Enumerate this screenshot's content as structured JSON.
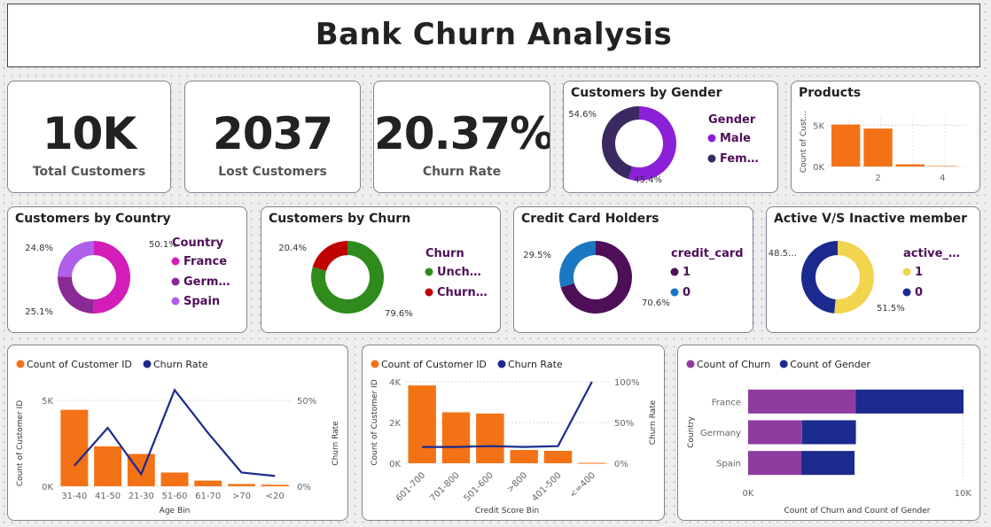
{
  "title": "Bank  Churn Analysis",
  "kpis": [
    {
      "value": "10K",
      "label": "Total Customers"
    },
    {
      "value": "2037",
      "label": "Lost Customers"
    },
    {
      "value": "20.37%",
      "label": "Churn Rate"
    }
  ],
  "colors": {
    "orange": "#F47216",
    "navy": "#1B2A8E",
    "purple": "#8E3CA0",
    "magenta": "#D21DB8",
    "darkPurple": "#4E0F58",
    "green": "#2E8B1C",
    "red": "#C00000",
    "blue": "#1A78C2",
    "yellow": "#F2D44E"
  },
  "chart_data": [
    {
      "type": "pie",
      "variant": "donut",
      "title": "Customers by Gender",
      "legend_title": "Gender",
      "slices": [
        {
          "label": "Male",
          "legend_text": "Male",
          "value": 54.6,
          "value_label": "54.6%",
          "color": "#8B20D8"
        },
        {
          "label": "Female",
          "legend_text": "Fem…",
          "value": 45.4,
          "value_label": "45.4%",
          "color": "#3A2A60"
        }
      ]
    },
    {
      "type": "bar",
      "title": "Products",
      "ylabel": "Count of Cust…",
      "x": [
        1,
        2,
        3,
        4
      ],
      "values": [
        5084,
        4590,
        266,
        60
      ],
      "xticks": [
        "2",
        "4"
      ],
      "yticks": [
        "0K",
        "5K"
      ],
      "ylim": [
        0,
        6000
      ]
    },
    {
      "type": "pie",
      "variant": "donut",
      "title": "Customers by Country",
      "legend_title": "Country",
      "slices": [
        {
          "label": "France",
          "legend_text": "France",
          "value": 50.1,
          "value_label": "50.1%",
          "color": "#D21DB8"
        },
        {
          "label": "Germany",
          "legend_text": "Germ…",
          "value": 25.1,
          "value_label": "25.1%",
          "color": "#8A2A96"
        },
        {
          "label": "Spain",
          "legend_text": "Spain",
          "value": 24.8,
          "value_label": "24.8%",
          "color": "#B060E8"
        }
      ]
    },
    {
      "type": "pie",
      "variant": "donut",
      "title": "Customers by Churn",
      "legend_title": "Churn",
      "slices": [
        {
          "label": "Unchurned",
          "legend_text": "Unch…",
          "value": 79.6,
          "value_label": "79.6%",
          "color": "#2E8B1C"
        },
        {
          "label": "Churned",
          "legend_text": "Churn…",
          "value": 20.4,
          "value_label": "20.4%",
          "color": "#C00000"
        }
      ]
    },
    {
      "type": "pie",
      "variant": "donut",
      "title": "Credit Card Holders",
      "legend_title": "credit_card",
      "slices": [
        {
          "label": "1",
          "legend_text": "1",
          "value": 70.6,
          "value_label": "70.6%",
          "color": "#4E0F58"
        },
        {
          "label": "0",
          "legend_text": "0",
          "value": 29.5,
          "value_label": "29.5%",
          "color": "#1A78C2"
        }
      ]
    },
    {
      "type": "pie",
      "variant": "donut",
      "title": "Active V/S Inactive member",
      "legend_title": "active_…",
      "slices": [
        {
          "label": "1",
          "legend_text": "1",
          "value": 51.5,
          "value_label": "51.5%",
          "color": "#F2D44E"
        },
        {
          "label": "0",
          "legend_text": "0",
          "value": 48.5,
          "value_label": "48.5…",
          "color": "#1B2A8E"
        }
      ]
    },
    {
      "type": "bar",
      "subtype": "combo-bar-line",
      "legend": [
        "Count of Customer ID",
        "Churn Rate"
      ],
      "categories": [
        "31-40",
        "41-50",
        "21-30",
        "51-60",
        "61-70",
        ">70",
        "<20"
      ],
      "series": [
        {
          "name": "Count of Customer ID",
          "kind": "bar",
          "values": [
            4450,
            2320,
            1880,
            800,
            330,
            130,
            90
          ]
        },
        {
          "name": "Churn Rate",
          "kind": "line",
          "values": [
            12,
            34,
            7,
            56,
            31,
            8,
            6
          ]
        }
      ],
      "xlabel": "Age Bin",
      "ylabel": "Count of Customer ID",
      "y2label": "Churn Rate",
      "yticks": [
        "0K",
        "5K"
      ],
      "ylim": [
        0,
        5000
      ],
      "y2ticks": [
        "0%",
        "50%"
      ],
      "y2lim": [
        0,
        50
      ]
    },
    {
      "type": "bar",
      "subtype": "combo-bar-line",
      "legend": [
        "Count of Customer ID",
        "Churn Rate"
      ],
      "categories": [
        "601-700",
        "701-800",
        "501-600",
        ">800",
        "401-500",
        "<=400"
      ],
      "series": [
        {
          "name": "Count of Customer ID",
          "kind": "bar",
          "values": [
            3820,
            2500,
            2440,
            650,
            610,
            20
          ]
        },
        {
          "name": "Churn Rate",
          "kind": "line",
          "values": [
            20,
            20,
            21,
            20,
            21,
            100
          ]
        }
      ],
      "xlabel": "Credit Score Bin",
      "ylabel": "Count of Customer ID",
      "y2label": "Churn Rate",
      "yticks": [
        "0K",
        "2K",
        "4K"
      ],
      "ylim": [
        0,
        4000
      ],
      "y2ticks": [
        "0%",
        "50%",
        "100%"
      ],
      "y2lim": [
        0,
        100
      ]
    },
    {
      "type": "bar",
      "subtype": "stacked-horizontal",
      "legend": [
        "Count of Churn",
        "Count of Gender"
      ],
      "categories": [
        "France",
        "Germany",
        "Spain"
      ],
      "series": [
        {
          "name": "Count of Churn",
          "values": [
            5014,
            2509,
            2477
          ]
        },
        {
          "name": "Count of Gender",
          "values": [
            5014,
            2509,
            2477
          ]
        }
      ],
      "xlabel": "Count of Churn and Count of Gender",
      "ylabel": "Country",
      "xticks": [
        "0K",
        "10K"
      ],
      "xlim": [
        0,
        10000
      ]
    }
  ]
}
